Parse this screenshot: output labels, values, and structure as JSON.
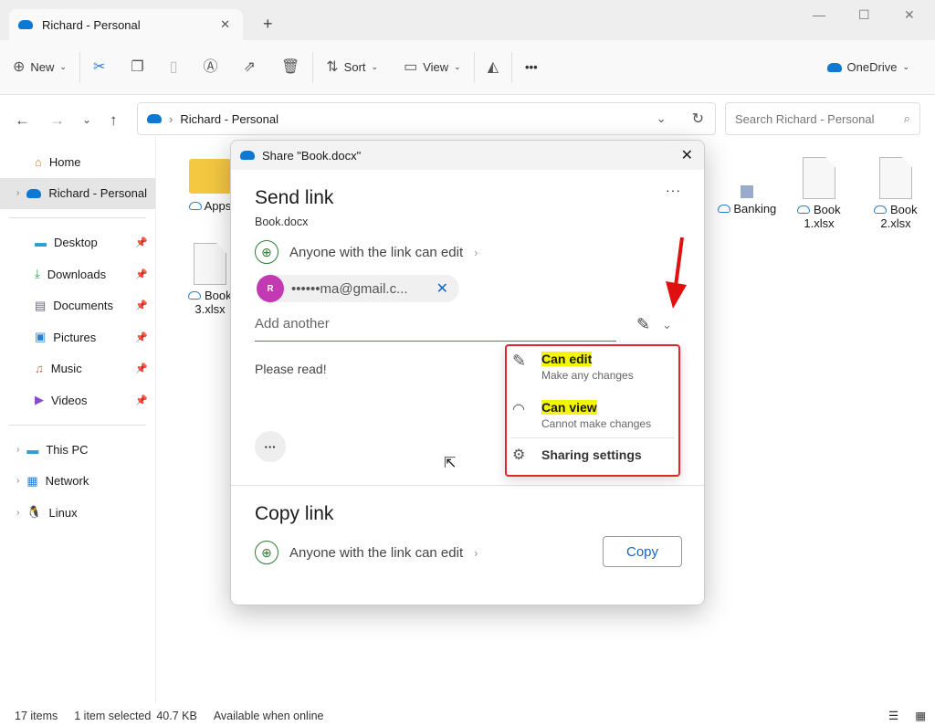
{
  "window": {
    "tab_title": "Richard - Personal",
    "new_tab": "+",
    "min": "—",
    "max": "☐",
    "close": "✕"
  },
  "toolbar": {
    "new": "New",
    "sort": "Sort",
    "view": "View",
    "more": "•••",
    "onedrive": "OneDrive"
  },
  "address": {
    "path": "Richard - Personal",
    "search_placeholder": "Search Richard - Personal"
  },
  "sidebar": {
    "home": "Home",
    "current": "Richard - Personal",
    "pinned": [
      "Desktop",
      "Downloads",
      "Documents",
      "Pictures",
      "Music",
      "Videos"
    ],
    "bottom": [
      "This PC",
      "Network",
      "Linux"
    ]
  },
  "files": [
    {
      "name": "Apps"
    },
    {
      "name": "Book 3.xlsx"
    },
    {
      "name": "Banking"
    },
    {
      "name": "Book 1.xlsx"
    },
    {
      "name": "Book 2.xlsx"
    }
  ],
  "status": {
    "count": "17 items",
    "selected": "1 item selected",
    "size": "40.7 KB",
    "availability": "Available when online"
  },
  "dialog": {
    "title": "Share \"Book.docx\"",
    "send_heading": "Send link",
    "filename": "Book.docx",
    "link_permission": "Anyone with the link can edit",
    "recipient_initial": "R",
    "recipient_email": "••••••ma@gmail.c...",
    "add_placeholder": "Add another",
    "message": "Please read!",
    "copy_heading": "Copy link",
    "copy_permission": "Anyone with the link can edit",
    "copy_button": "Copy"
  },
  "menu": {
    "items": [
      {
        "label": "Can edit",
        "sub": "Make any changes"
      },
      {
        "label": "Can view",
        "sub": "Cannot make changes"
      }
    ],
    "settings": "Sharing settings"
  },
  "colors": {
    "accent": "#0f78d4",
    "highlight_border": "#e0272c",
    "avatar": "#c239b3"
  }
}
